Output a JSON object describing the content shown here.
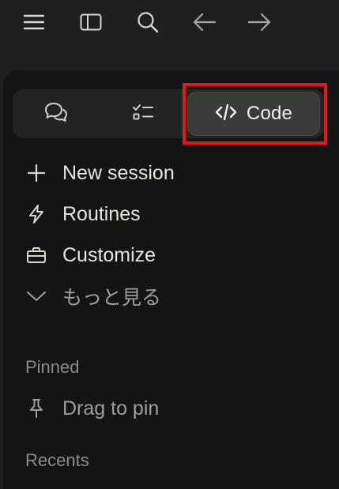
{
  "toolbar": {
    "icons": [
      "menu-icon",
      "sidebar-toggle-icon",
      "search-icon",
      "arrow-left-icon",
      "arrow-right-icon"
    ]
  },
  "switcher": {
    "tabs": [
      {
        "icon": "chat-icon",
        "label": ""
      },
      {
        "icon": "tasks-icon",
        "label": ""
      },
      {
        "icon": "code-icon",
        "label": "Code"
      }
    ],
    "active": "Code",
    "highlight_color": "#e8161c"
  },
  "nav": {
    "new_session": "New session",
    "routines": "Routines",
    "customize": "Customize",
    "more": "もっと見る"
  },
  "pinned": {
    "heading": "Pinned",
    "drag_to_pin": "Drag to pin"
  },
  "recents": {
    "heading": "Recents"
  }
}
